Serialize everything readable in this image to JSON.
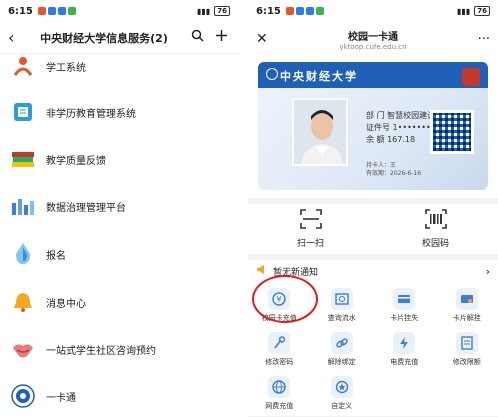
{
  "left": {
    "status": {
      "time": "6:15",
      "battery": "76"
    },
    "header": {
      "back_icon": "chevron-left-icon",
      "title": "中央财经大学信息服务(2)",
      "search_icon": "search-icon",
      "add_icon": "plus-icon"
    },
    "items": [
      {
        "label": "学工系统",
        "icon": "person-icon"
      },
      {
        "label": "非学历教育管理系统",
        "icon": "book-icon"
      },
      {
        "label": "教学质量反馈",
        "icon": "books-icon"
      },
      {
        "label": "数据治理管理平台",
        "icon": "database-icon"
      },
      {
        "label": "报名",
        "icon": "signup-icon"
      },
      {
        "label": "消息中心",
        "icon": "bell-icon"
      },
      {
        "label": "一站式学生社区咨询预约",
        "icon": "handshake-icon"
      },
      {
        "label": "一卡通",
        "icon": "school-seal-icon"
      }
    ]
  },
  "right": {
    "status": {
      "time": "6:15",
      "battery": "76"
    },
    "header": {
      "title": "校园一卡通",
      "subtitle": "yktoop.cufe.edu.cn"
    },
    "card": {
      "school_name": "中央财经大学",
      "dept": "部 门 智慧校园建设中心",
      "cert": "证件号 1•••••••",
      "balance": "余 额 167.18",
      "foot1": "持卡人：王",
      "foot2": "有效期：2026-6-16"
    },
    "scan": [
      {
        "label": "扫一扫",
        "icon": "scan-icon"
      },
      {
        "label": "校园码",
        "icon": "barcode-icon"
      }
    ],
    "notice": {
      "text": "暂无新通知"
    },
    "grid": [
      {
        "label": "校园卡充值",
        "icon": "recharge-icon"
      },
      {
        "label": "查询流水",
        "icon": "query-icon"
      },
      {
        "label": "卡片挂失",
        "icon": "card-loss-icon"
      },
      {
        "label": "卡片解挂",
        "icon": "card-unlock-icon"
      },
      {
        "label": "修改密码",
        "icon": "password-icon"
      },
      {
        "label": "解除绑定",
        "icon": "unlink-icon"
      },
      {
        "label": "电费充值",
        "icon": "electric-icon"
      },
      {
        "label": "修改限额",
        "icon": "limit-icon"
      },
      {
        "label": "网费充值",
        "icon": "network-icon"
      },
      {
        "label": "自定义",
        "icon": "custom-icon"
      }
    ]
  }
}
